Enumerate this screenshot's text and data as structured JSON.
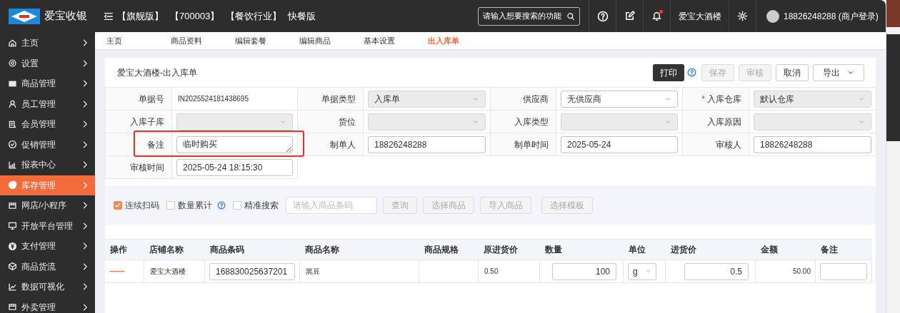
{
  "header": {
    "brand": "爱宝收银",
    "tags": [
      "【旗舰版】",
      "【700003】",
      "【餐饮行业】",
      "快餐版"
    ],
    "search": {
      "placeholder": "请输入想要搜索的功能"
    },
    "notification_dot": true,
    "store": "爱宝大酒楼",
    "user": "18826248288",
    "login_type": "(商户登录)"
  },
  "sidebar": {
    "items": [
      {
        "label": "主页",
        "selected": false
      },
      {
        "label": "设置",
        "selected": false
      },
      {
        "label": "商品管理",
        "selected": false
      },
      {
        "label": "员工管理",
        "selected": false
      },
      {
        "label": "会员管理",
        "selected": false
      },
      {
        "label": "促销管理",
        "selected": false
      },
      {
        "label": "报表中心",
        "selected": false
      },
      {
        "label": "库存管理",
        "selected": true
      },
      {
        "label": "网店/小程序",
        "selected": false
      },
      {
        "label": "开放平台管理",
        "selected": false
      },
      {
        "label": "支付管理",
        "selected": false
      },
      {
        "label": "商品货流",
        "selected": false
      },
      {
        "label": "数据可视化",
        "selected": false
      },
      {
        "label": "外卖管理",
        "selected": false
      }
    ]
  },
  "tabs": [
    {
      "label": "主页",
      "selected": false
    },
    {
      "label": "商品资料",
      "selected": false
    },
    {
      "label": "编辑套餐",
      "selected": false
    },
    {
      "label": "编辑商品",
      "selected": false
    },
    {
      "label": "基本设置",
      "selected": false
    },
    {
      "label": "出入库单",
      "selected": true
    }
  ],
  "form": {
    "title": "爱宝大酒楼-出入库单",
    "buttons": [
      {
        "label": "打印",
        "kind": "primary",
        "disabled": false
      },
      {
        "label": "保存",
        "kind": "normal",
        "disabled": true
      },
      {
        "label": "审核",
        "kind": "normal",
        "disabled": true
      },
      {
        "label": "取消",
        "kind": "normal",
        "disabled": false
      },
      {
        "label": "导出",
        "kind": "dropdown",
        "disabled": false
      }
    ],
    "fields": [
      {
        "label": "单据号",
        "kind": "text",
        "value": "IN2025524181438695",
        "highlighted": false
      },
      {
        "label": "单据类型",
        "kind": "select",
        "value": "入库单",
        "disabled": true,
        "highlighted": false
      },
      {
        "label": "供应商",
        "kind": "select",
        "value": "无供应商",
        "disabled": false,
        "highlighted": false
      },
      {
        "label": "入库仓库",
        "kind": "select",
        "value": "默认仓库",
        "required_mark": "*",
        "disabled": true,
        "highlighted": false
      },
      {
        "label": "入库子库",
        "kind": "select",
        "disabled": true,
        "highlighted": false
      },
      {
        "label": "货位",
        "kind": "select",
        "disabled": true,
        "highlighted": false
      },
      {
        "label": "入库类型",
        "kind": "select",
        "disabled": true,
        "highlighted": false
      },
      {
        "label": "入库原因",
        "kind": "select",
        "disabled": true,
        "highlighted": false
      },
      {
        "label": "备注",
        "kind": "textarea",
        "value": "临时购买",
        "disabled": false,
        "highlighted": true
      },
      {
        "label": "制单人",
        "kind": "input",
        "value": "18826248288",
        "disabled": false,
        "highlighted": false
      },
      {
        "label": "制单时间",
        "kind": "input",
        "value": "2025-05-24",
        "disabled": false,
        "highlighted": false
      },
      {
        "label": "审核人",
        "kind": "input",
        "value": "18826248288",
        "disabled": false,
        "highlighted": false
      },
      {
        "label": "审核时间",
        "kind": "input",
        "value": "2025-05-24 18:15:30",
        "disabled": false,
        "highlighted": false
      }
    ]
  },
  "toolbar": {
    "options": [
      {
        "label": "连续扫码",
        "checked": true,
        "help": false
      },
      {
        "label": "数量累计",
        "checked": false,
        "help": true
      },
      {
        "label": "精准搜索",
        "checked": false,
        "help": false
      }
    ],
    "barcode": {
      "placeholder": "请输入商品条码"
    },
    "buttons": [
      {
        "label": "查询",
        "disabled": true
      },
      {
        "label": "选择商品",
        "disabled": true
      },
      {
        "label": "导入商品",
        "disabled": true
      },
      {
        "label": "选择模板",
        "disabled": true
      }
    ]
  },
  "table": {
    "columns": [
      "操作",
      "店铺名称",
      "商品条码",
      "商品名称",
      "商品规格",
      "原进货价",
      "数量",
      "单位",
      "进货价",
      "金额",
      "备注"
    ],
    "rows": [
      [
        {
          "kind": "dash"
        },
        {
          "kind": "text",
          "value": "爱宝大酒楼"
        },
        {
          "kind": "input",
          "value": "168830025637201"
        },
        {
          "kind": "text",
          "value": "黑豆"
        },
        {
          "kind": "text"
        },
        {
          "kind": "text",
          "value": "0.50"
        },
        {
          "kind": "number",
          "value": "100"
        },
        {
          "kind": "select",
          "value": "g"
        },
        {
          "kind": "number",
          "value": "0.5"
        },
        {
          "kind": "amount",
          "value": "50.00"
        },
        {
          "kind": "input"
        }
      ]
    ]
  }
}
